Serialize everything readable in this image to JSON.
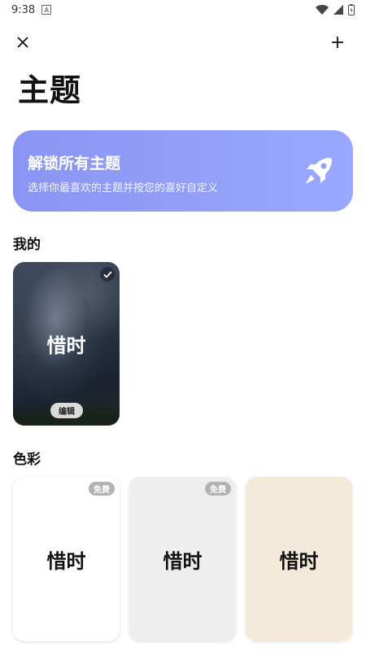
{
  "status": {
    "time": "9:38",
    "notif": "A"
  },
  "header": {
    "title": "主题"
  },
  "banner": {
    "title": "解锁所有主题",
    "subtitle": "选择你最喜欢的主题并按您的喜好自定义",
    "icon": "rocket-icon"
  },
  "sections": {
    "mine": {
      "title": "我的",
      "card": {
        "label": "惜时",
        "edit_label": "编辑",
        "selected": true
      }
    },
    "colors": {
      "title": "色彩",
      "cards": [
        {
          "label": "惜时",
          "badge": "免费",
          "bg": "#ffffff"
        },
        {
          "label": "惜时",
          "badge": "免费",
          "bg": "#eeeeee"
        },
        {
          "label": "惜时",
          "badge": "",
          "bg": "#f4ead9"
        }
      ]
    }
  },
  "colors": {
    "banner_start": "#8a95f2",
    "banner_end": "#98a8ff"
  }
}
